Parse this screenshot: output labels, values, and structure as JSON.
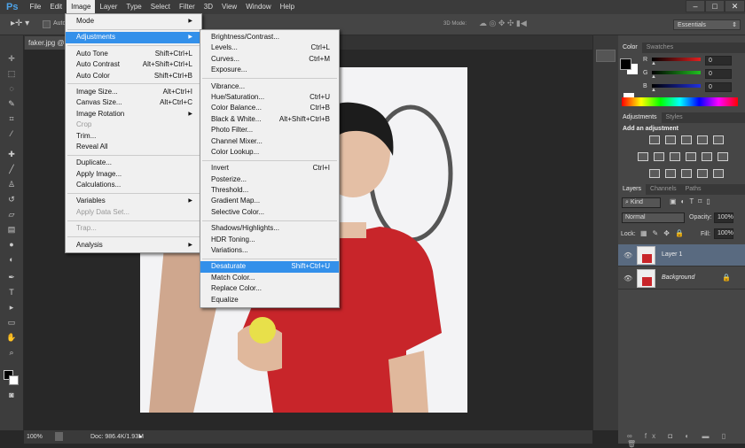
{
  "app": {
    "logo": "Ps"
  },
  "menubar": [
    "File",
    "Edit",
    "Image",
    "Layer",
    "Type",
    "Select",
    "Filter",
    "3D",
    "View",
    "Window",
    "Help"
  ],
  "window_controls": {
    "minimize": "–",
    "maximize": "□",
    "close": "✕"
  },
  "options": {
    "auto_select_label": "Auto",
    "mode_label": "3D Mode:",
    "workspace": "Essentials"
  },
  "document_tab": "faker.jpg @",
  "image_menu": [
    {
      "label": "Mode",
      "arrow": true
    },
    {
      "sep": true
    },
    {
      "label": "Adjustments",
      "arrow": true,
      "highlight": true
    },
    {
      "sep": true
    },
    {
      "label": "Auto Tone",
      "shortcut": "Shift+Ctrl+L"
    },
    {
      "label": "Auto Contrast",
      "shortcut": "Alt+Shift+Ctrl+L"
    },
    {
      "label": "Auto Color",
      "shortcut": "Shift+Ctrl+B"
    },
    {
      "sep": true
    },
    {
      "label": "Image Size...",
      "shortcut": "Alt+Ctrl+I"
    },
    {
      "label": "Canvas Size...",
      "shortcut": "Alt+Ctrl+C"
    },
    {
      "label": "Image Rotation",
      "arrow": true
    },
    {
      "label": "Crop",
      "disabled": true
    },
    {
      "label": "Trim..."
    },
    {
      "label": "Reveal All"
    },
    {
      "sep": true
    },
    {
      "label": "Duplicate..."
    },
    {
      "label": "Apply Image..."
    },
    {
      "label": "Calculations..."
    },
    {
      "sep": true
    },
    {
      "label": "Variables",
      "arrow": true
    },
    {
      "label": "Apply Data Set...",
      "disabled": true
    },
    {
      "sep": true
    },
    {
      "label": "Trap...",
      "disabled": true
    },
    {
      "sep": true
    },
    {
      "label": "Analysis",
      "arrow": true
    }
  ],
  "adjustments_menu": [
    {
      "label": "Brightness/Contrast..."
    },
    {
      "label": "Levels...",
      "shortcut": "Ctrl+L"
    },
    {
      "label": "Curves...",
      "shortcut": "Ctrl+M"
    },
    {
      "label": "Exposure..."
    },
    {
      "sep": true
    },
    {
      "label": "Vibrance..."
    },
    {
      "label": "Hue/Saturation...",
      "shortcut": "Ctrl+U"
    },
    {
      "label": "Color Balance...",
      "shortcut": "Ctrl+B"
    },
    {
      "label": "Black & White...",
      "shortcut": "Alt+Shift+Ctrl+B"
    },
    {
      "label": "Photo Filter..."
    },
    {
      "label": "Channel Mixer..."
    },
    {
      "label": "Color Lookup..."
    },
    {
      "sep": true
    },
    {
      "label": "Invert",
      "shortcut": "Ctrl+I"
    },
    {
      "label": "Posterize..."
    },
    {
      "label": "Threshold..."
    },
    {
      "label": "Gradient Map..."
    },
    {
      "label": "Selective Color..."
    },
    {
      "sep": true
    },
    {
      "label": "Shadows/Highlights..."
    },
    {
      "label": "HDR Toning..."
    },
    {
      "label": "Variations..."
    },
    {
      "sep": true
    },
    {
      "label": "Desaturate",
      "shortcut": "Shift+Ctrl+U",
      "highlight": true
    },
    {
      "label": "Match Color..."
    },
    {
      "label": "Replace Color..."
    },
    {
      "label": "Equalize"
    }
  ],
  "color_panel": {
    "tabs": [
      "Color",
      "Swatches"
    ],
    "channels": [
      {
        "name": "R",
        "value": "0",
        "color": "#e02020"
      },
      {
        "name": "G",
        "value": "0",
        "color": "#20c020"
      },
      {
        "name": "B",
        "value": "0",
        "color": "#2030e0"
      }
    ]
  },
  "adjustments_panel": {
    "tabs": [
      "Adjustments",
      "Styles"
    ],
    "heading": "Add an adjustment"
  },
  "layers_panel": {
    "tabs": [
      "Layers",
      "Channels",
      "Paths"
    ],
    "filter": "Kind",
    "blend_mode": "Normal",
    "opacity_label": "Opacity:",
    "opacity": "100%",
    "lock_label": "Lock:",
    "fill_label": "Fill:",
    "fill": "100%",
    "layers": [
      {
        "name": "Layer 1",
        "selected": true
      },
      {
        "name": "Background",
        "locked": true
      }
    ]
  },
  "status": {
    "zoom": "100%",
    "doc": "Doc: 986.4K/1.93M"
  }
}
